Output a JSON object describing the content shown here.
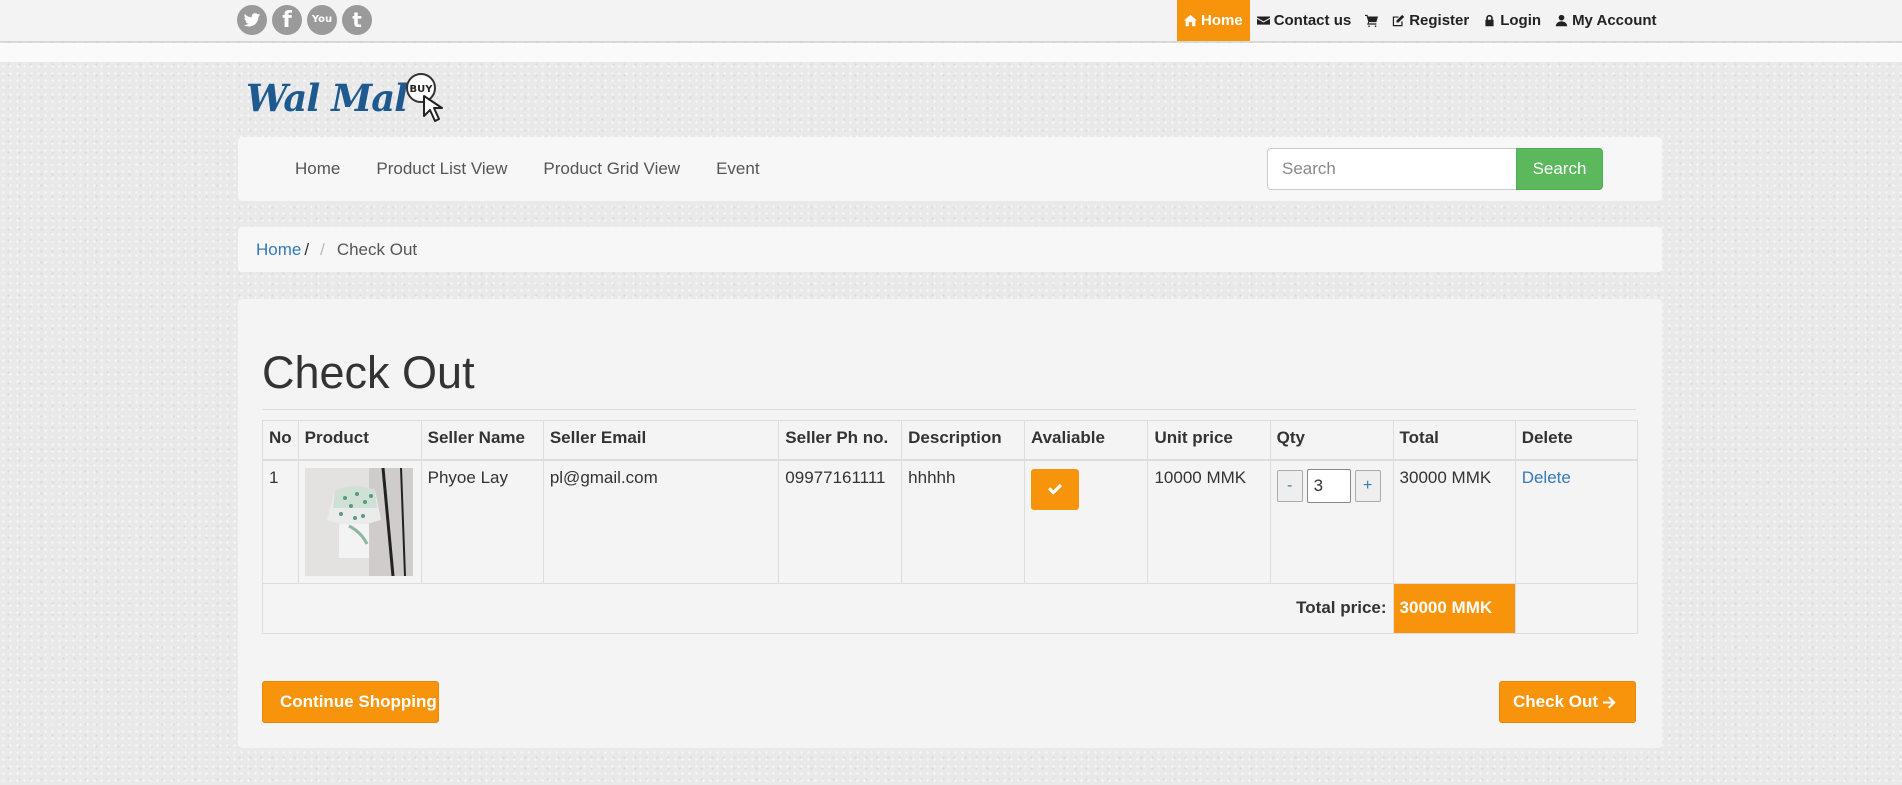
{
  "social": [
    {
      "name": "twitter-icon"
    },
    {
      "name": "facebook-icon",
      "glyph": "f"
    },
    {
      "name": "youtube-icon",
      "glyph": "You"
    },
    {
      "name": "tumblr-icon",
      "glyph": "t"
    }
  ],
  "toplinks": {
    "home": "Home",
    "contact": "Contact us",
    "register": "Register",
    "login": "Login",
    "account": "My Account"
  },
  "logo": {
    "text": "Wal Mal",
    "badge": "BUY"
  },
  "nav": {
    "items": [
      "Home",
      "Product List View",
      "Product Grid View",
      "Event"
    ],
    "search_placeholder": "Search",
    "search_button": "Search"
  },
  "breadcrumb": {
    "home": "Home",
    "separator": "/",
    "current": "Check Out"
  },
  "page": {
    "title": "Check Out"
  },
  "table": {
    "headers": [
      "No",
      "Product",
      "Seller Name",
      "Seller Email",
      "Seller Ph no.",
      "Description",
      "Avaliable",
      "Unit price",
      "Qty",
      "Total",
      "Delete"
    ],
    "rows": [
      {
        "no": "1",
        "seller_name": "Phyoe Lay",
        "seller_email": "pl@gmail.com",
        "seller_phone": "09977161111",
        "description": "hhhhh",
        "unit_price": "10000 MMK",
        "qty": "3",
        "total": "30000 MMK",
        "delete": "Delete"
      }
    ],
    "qty_minus": "-",
    "qty_plus": "+",
    "total_label": "Total price:",
    "total_value": "30000 MMK"
  },
  "buttons": {
    "continue": "Continue Shopping",
    "checkout": "Check Out"
  },
  "colors": {
    "accent": "#f7940c",
    "link": "#337ab7",
    "success": "#5cb85c"
  }
}
